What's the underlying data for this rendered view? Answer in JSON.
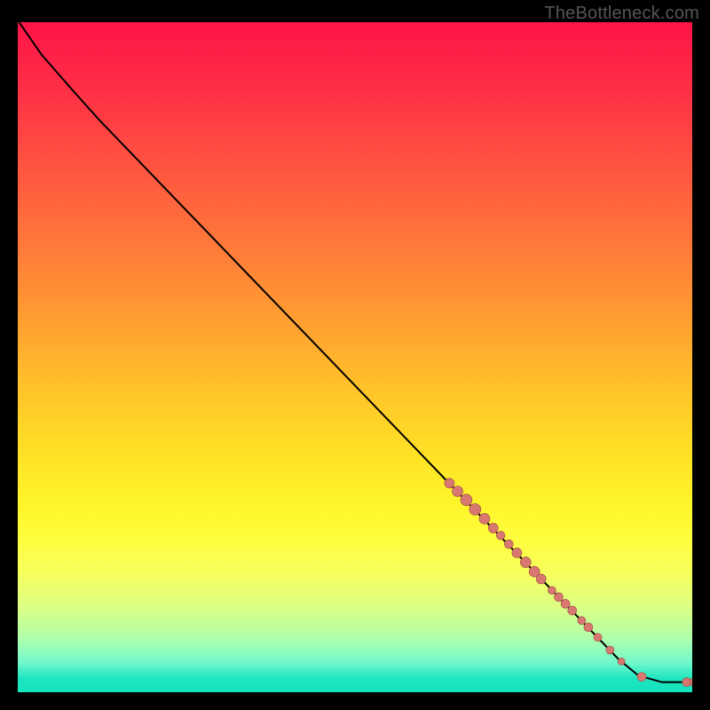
{
  "watermark": "TheBottleneck.com",
  "chart_data": {
    "type": "line",
    "title": "",
    "xlabel": "",
    "ylabel": "",
    "xlim": [
      0,
      100
    ],
    "ylim": [
      0,
      100
    ],
    "curve": [
      {
        "x": 0.2,
        "y": 100
      },
      {
        "x": 3.5,
        "y": 95.2
      },
      {
        "x": 8.0,
        "y": 90.0
      },
      {
        "x": 12.0,
        "y": 85.5
      },
      {
        "x": 89.0,
        "y": 5.0
      },
      {
        "x": 92.0,
        "y": 2.5
      },
      {
        "x": 95.5,
        "y": 1.5
      },
      {
        "x": 100.0,
        "y": 1.5
      }
    ],
    "series": [
      {
        "name": "highlighted-points",
        "color": "#d87870",
        "points": [
          {
            "x": 64.0,
            "y": 31.2,
            "r": 5.5
          },
          {
            "x": 65.2,
            "y": 30.0,
            "r": 6.0
          },
          {
            "x": 66.5,
            "y": 28.7,
            "r": 6.5
          },
          {
            "x": 67.8,
            "y": 27.3,
            "r": 6.5
          },
          {
            "x": 69.2,
            "y": 25.9,
            "r": 6.0
          },
          {
            "x": 70.5,
            "y": 24.5,
            "r": 5.5
          },
          {
            "x": 71.6,
            "y": 23.4,
            "r": 4.8
          },
          {
            "x": 72.8,
            "y": 22.1,
            "r": 5.0
          },
          {
            "x": 74.0,
            "y": 20.8,
            "r": 5.5
          },
          {
            "x": 75.3,
            "y": 19.4,
            "r": 6.0
          },
          {
            "x": 76.6,
            "y": 18.0,
            "r": 6.0
          },
          {
            "x": 77.6,
            "y": 16.9,
            "r": 5.5
          },
          {
            "x": 79.2,
            "y": 15.2,
            "r": 4.5
          },
          {
            "x": 80.2,
            "y": 14.2,
            "r": 5.0
          },
          {
            "x": 81.2,
            "y": 13.2,
            "r": 5.0
          },
          {
            "x": 82.2,
            "y": 12.2,
            "r": 5.0
          },
          {
            "x": 83.6,
            "y": 10.7,
            "r": 4.5
          },
          {
            "x": 84.6,
            "y": 9.7,
            "r": 5.0
          },
          {
            "x": 86.0,
            "y": 8.2,
            "r": 4.5
          },
          {
            "x": 87.8,
            "y": 6.3,
            "r": 4.5
          },
          {
            "x": 89.5,
            "y": 4.6,
            "r": 4.0
          },
          {
            "x": 92.5,
            "y": 2.3,
            "r": 5.0
          },
          {
            "x": 99.2,
            "y": 1.5,
            "r": 5.0
          },
          {
            "x": 100.3,
            "y": 1.5,
            "r": 5.0
          }
        ]
      }
    ]
  }
}
